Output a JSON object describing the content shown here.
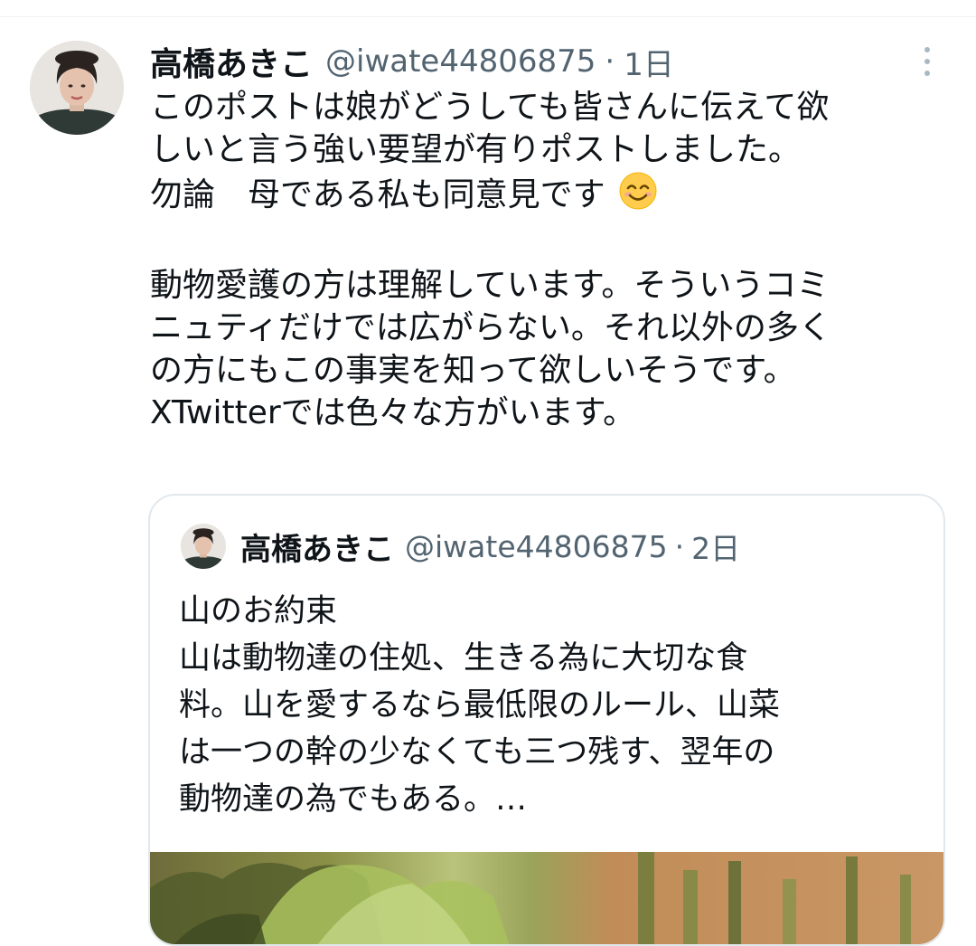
{
  "tweet": {
    "display_name": "高橋あきこ",
    "handle": "@iwate44806875",
    "separator": "·",
    "time": "1日",
    "lines": [
      "このポストは娘がどうしても皆さんに伝えて欲",
      "しいと言う強い要望が有りポストしました。",
      "勿論　母である私も同意見です",
      "",
      "動物愛護の方は理解しています。そういうコミ",
      "ニュティだけでは広がらない。それ以外の多く",
      "の方にもこの事実を知って欲しいそうです。",
      "XTwitterでは色々な方がいます。"
    ],
    "emoji": "smiling-face-emoji"
  },
  "quoted": {
    "display_name": "高橋あきこ",
    "handle": "@iwate44806875",
    "separator": "·",
    "time": "2日",
    "lines": [
      "山のお約束",
      "山は動物達の住処、生きる為に大切な食",
      "料。山を愛するなら最低限のルール、山菜",
      "は一つの幹の少なくても三つ残す、翌年の",
      "動物達の為でもある。…"
    ],
    "media": "plant-photo"
  },
  "colors": {
    "text": "#0f1419",
    "secondary": "#536471",
    "border": "#e1e8ed",
    "emoji_face": "#ffcc4d"
  },
  "icons": [
    "more-vertical-icon"
  ]
}
